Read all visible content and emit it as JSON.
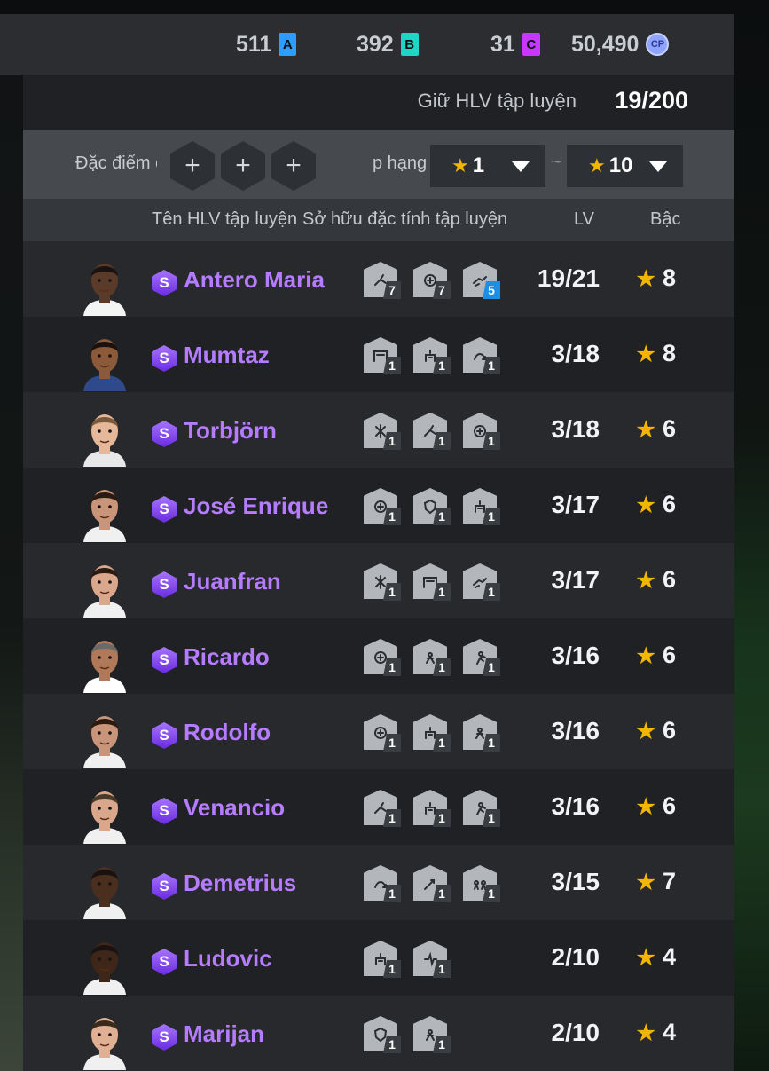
{
  "currency": {
    "a": {
      "value": "511",
      "icon": "A",
      "color": "#2f9cff"
    },
    "b": {
      "value": "392",
      "icon": "B",
      "color": "#1fd6c4"
    },
    "c": {
      "value": "31",
      "icon": "C",
      "color": "#c638ff"
    },
    "cp": {
      "value": "50,490",
      "icon": "CP"
    }
  },
  "hold": {
    "label": "Giữ HLV tập luyện",
    "value": "19/200"
  },
  "filter": {
    "traits_label": "Đặc điểm c",
    "add_symbol": "+",
    "rank_label": "p hạng",
    "star": "★",
    "min": "1",
    "tilde": "~",
    "max": "10"
  },
  "columns": {
    "name": "Tên HLV tập luyện",
    "traits": "Sở hữu đặc tính tập luyện",
    "lv": "LV",
    "tier": "Bậc"
  },
  "badge_letter": "S",
  "star_symbol": "★",
  "rows": [
    {
      "name": "Antero Maria",
      "lv": "19/21",
      "tier": "8",
      "traits": [
        {
          "icon": "kick-icon",
          "level": "7"
        },
        {
          "icon": "ball-icon",
          "level": "7"
        },
        {
          "icon": "dribble-icon",
          "level": "5",
          "highlight": true
        }
      ],
      "skin": "#5a3a28",
      "hair": "#1a1210",
      "shirt": "#f4f4f4"
    },
    {
      "name": "Mumtaz",
      "lv": "3/18",
      "tier": "8",
      "traits": [
        {
          "icon": "goal-icon",
          "level": "1"
        },
        {
          "icon": "drill-icon",
          "level": "1"
        },
        {
          "icon": "pass-icon",
          "level": "1"
        }
      ],
      "skin": "#8a5a3a",
      "hair": "#1a1210",
      "shirt": "#2e4a8a"
    },
    {
      "name": "Torbjörn",
      "lv": "3/18",
      "tier": "6",
      "traits": [
        {
          "icon": "tactic-icon",
          "level": "1"
        },
        {
          "icon": "kick-icon",
          "level": "1"
        },
        {
          "icon": "ball-icon",
          "level": "1"
        }
      ],
      "skin": "#e6b89a",
      "hair": "#7a5a3a",
      "shirt": "#e8e8e8"
    },
    {
      "name": "José Enrique",
      "lv": "3/17",
      "tier": "6",
      "traits": [
        {
          "icon": "ball-icon",
          "level": "1"
        },
        {
          "icon": "defense-icon",
          "level": "1"
        },
        {
          "icon": "drill-icon",
          "level": "1"
        }
      ],
      "skin": "#c8957a",
      "hair": "#2a1a12",
      "shirt": "#f0f0f0"
    },
    {
      "name": "Juanfran",
      "lv": "3/17",
      "tier": "6",
      "traits": [
        {
          "icon": "tactic-icon",
          "level": "1"
        },
        {
          "icon": "goal-icon",
          "level": "1"
        },
        {
          "icon": "dribble-icon",
          "level": "1"
        }
      ],
      "skin": "#d9a88c",
      "hair": "#2a1a12",
      "shirt": "#f0f0f0"
    },
    {
      "name": "Ricardo",
      "lv": "3/16",
      "tier": "6",
      "traits": [
        {
          "icon": "ball-icon",
          "level": "1"
        },
        {
          "icon": "fitness-icon",
          "level": "1"
        },
        {
          "icon": "run-icon",
          "level": "1"
        }
      ],
      "skin": "#b07a5a",
      "hair": "#6a6a6a",
      "shirt": "#ffffff"
    },
    {
      "name": "Rodolfo",
      "lv": "3/16",
      "tier": "6",
      "traits": [
        {
          "icon": "ball-icon",
          "level": "1"
        },
        {
          "icon": "drill-icon",
          "level": "1"
        },
        {
          "icon": "fitness-icon",
          "level": "1"
        }
      ],
      "skin": "#c8957a",
      "hair": "#2a1a12",
      "shirt": "#f0f0f0"
    },
    {
      "name": "Venancio",
      "lv": "3/16",
      "tier": "6",
      "traits": [
        {
          "icon": "kick-icon",
          "level": "1"
        },
        {
          "icon": "drill-icon",
          "level": "1"
        },
        {
          "icon": "run-icon",
          "level": "1"
        }
      ],
      "skin": "#d9a88c",
      "hair": "#4a3a2a",
      "shirt": "#f0f0f0"
    },
    {
      "name": "Demetrius",
      "lv": "3/15",
      "tier": "7",
      "traits": [
        {
          "icon": "pass-icon",
          "level": "1"
        },
        {
          "icon": "shot-icon",
          "level": "1"
        },
        {
          "icon": "team-icon",
          "level": "1"
        }
      ],
      "skin": "#4a2e1e",
      "hair": "#1a1210",
      "shirt": "#f0f0f0"
    },
    {
      "name": "Ludovic",
      "lv": "2/10",
      "tier": "4",
      "traits": [
        {
          "icon": "drill-icon",
          "level": "1"
        },
        {
          "icon": "agility-icon",
          "level": "1"
        }
      ],
      "skin": "#3e2618",
      "hair": "#1a1210",
      "shirt": "#f0f0f0"
    },
    {
      "name": "Marijan",
      "lv": "2/10",
      "tier": "4",
      "traits": [
        {
          "icon": "defense-icon",
          "level": "1"
        },
        {
          "icon": "fitness-icon",
          "level": "1"
        }
      ],
      "skin": "#e0b094",
      "hair": "#3a2a1a",
      "shirt": "#f0f0f0"
    }
  ]
}
